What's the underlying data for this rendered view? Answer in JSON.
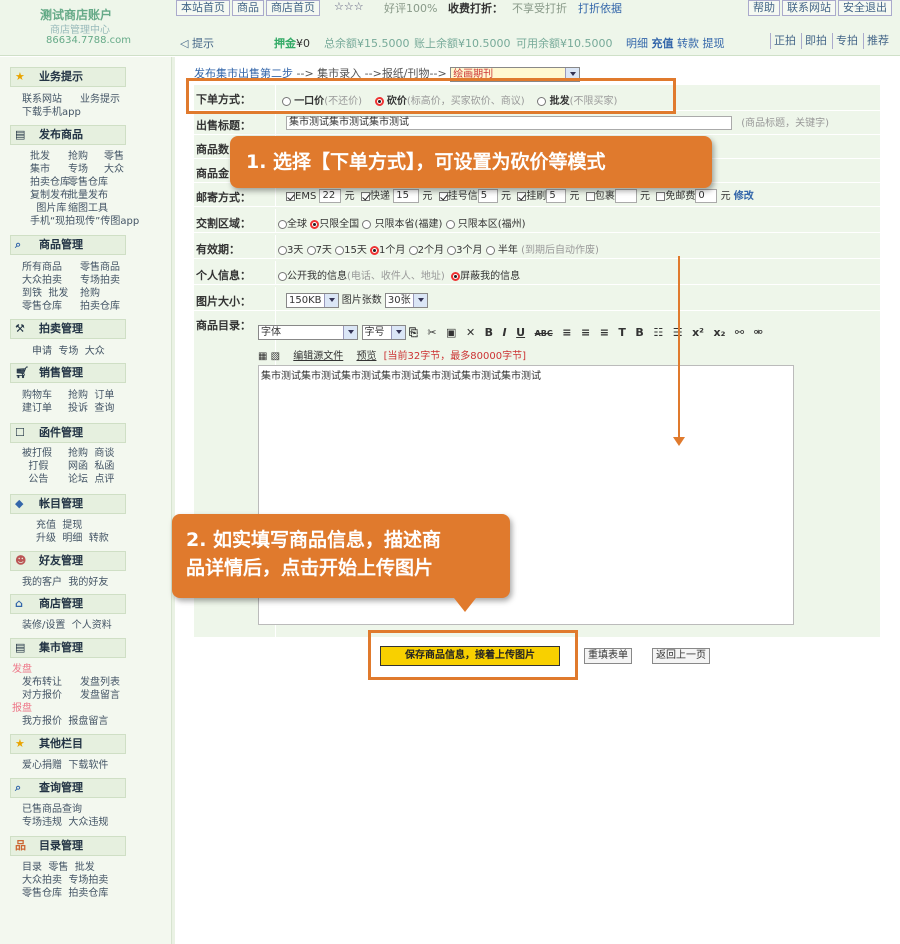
{
  "account": {
    "title": "测试商店账户",
    "subtitle": "商店管理中心",
    "domain": "86634.7788.com"
  },
  "topnav": {
    "items": [
      "本站首页",
      "商品",
      "商店首页"
    ],
    "stars": "☆☆☆",
    "rating": "好评100%",
    "fee_label": "收费打折：",
    "fee_value": "不享受打折",
    "fee_basis": "打折依据",
    "right": [
      "帮助",
      "联系网站",
      "安全退出"
    ]
  },
  "balance": {
    "tip": "提示",
    "deposit_label": "押金",
    "deposit": "¥0",
    "total": "总余额¥15.5000",
    "account": "账上余额¥10.5000",
    "available": "可用余额¥10.5000",
    "ops": [
      "明细",
      "充值",
      "转款",
      "提现"
    ],
    "sort": [
      "正拍",
      "即拍",
      "专拍",
      "推荐"
    ]
  },
  "sidebar": {
    "sections": [
      {
        "title": "业务提示",
        "icon": "star-icon",
        "left": "联系网站\n下载手机app",
        "right": "业务提示"
      },
      {
        "title": "发布商品",
        "icon": "document-icon",
        "left": "批发\n集市\n拍卖仓库\n复制发布\n  图片库\n手机“现拍现传”传图app",
        "right": "抢购\n专场\n零售仓库\n批量发布\n缩图工具",
        "right2": "零售\n大众"
      },
      {
        "title": "商品管理",
        "icon": "search-icon",
        "left": "所有商品\n大众拍卖\n到铁  批发\n零售仓库",
        "right": "零售商品\n专场拍卖\n抢购\n拍卖仓库"
      },
      {
        "title": "拍卖管理",
        "icon": "hammer-icon",
        "left": "申请  专场  大众"
      },
      {
        "title": "销售管理",
        "icon": "cart-icon",
        "left": "购物车\n建订单",
        "right": "抢购  订单\n投诉  查询"
      },
      {
        "title": "函件管理",
        "icon": "mail-icon",
        "left": "被打假\n  打假\n  公告",
        "right": "抢购  商谈\n网函  私函\n论坛  点评"
      },
      {
        "title": "帐目管理",
        "icon": "ticket-icon",
        "left": "充值  提现\n升级  明细  转款"
      },
      {
        "title": "好友管理",
        "icon": "people-icon",
        "left": "我的客户  我的好友"
      },
      {
        "title": "商店管理",
        "icon": "home-icon",
        "left": "装修/设置  个人资料"
      },
      {
        "title": "集市管理",
        "icon": "document-icon",
        "orange1": "发盘",
        "left": "发布转让\n对方报价",
        "right": "发盘列表\n发盘留言",
        "orange2": "报盘",
        "left2": "我方报价  报盘留言"
      },
      {
        "title": "其他栏目",
        "icon": "star-icon",
        "left": "爱心捐赠  下载软件"
      },
      {
        "title": "查询管理",
        "icon": "search-icon",
        "left": "已售商品查询\n专场违规  大众违规"
      },
      {
        "title": "目录管理",
        "icon": "tree-icon",
        "left": "目录  零售  批发\n大众拍卖  专场拍卖\n零售仓库  拍卖仓库"
      }
    ]
  },
  "breadcrumb": {
    "step": "发布集市出售第二步",
    "sep1": "-->",
    "cat1": "集市录入",
    "sep2": "-->",
    "cat2": "报纸/刊物",
    "sep3": "-->",
    "selected": "绘画期刊"
  },
  "form": {
    "order_mode": {
      "label": "下单方式：",
      "options": [
        {
          "name": "一口价",
          "hint": "(不还价)",
          "selected": false
        },
        {
          "name": "砍价",
          "hint": "(标高价，买家砍价、商议)",
          "selected": true
        },
        {
          "name": "批发",
          "hint": "(不限买家)",
          "selected": false
        }
      ]
    },
    "title": {
      "label": "出售标题：",
      "value": "集市测试集市测试集市测试",
      "hint": "(商品标题，关键字)"
    },
    "qty": {
      "label": "商品数"
    },
    "price": {
      "label": "商品金"
    },
    "shipping": {
      "label": "邮寄方式：",
      "ems": "EMS",
      "ems_val": "22",
      "express": "快递",
      "express_val": "15",
      "reg": "挂号信",
      "reg_val": "5",
      "print": "挂刷",
      "print_val": "5",
      "pkg": "包裹",
      "free": "免邮费",
      "free_val": "0",
      "unit": "元",
      "edit": "修改"
    },
    "region": {
      "label": "交割区域：",
      "options": [
        {
          "name": "全球",
          "sel": false
        },
        {
          "name": "只限全国",
          "sel": true
        },
        {
          "name": "只限本省(福建)",
          "sel": false
        },
        {
          "name": "只限本区(福州)",
          "sel": false
        }
      ]
    },
    "validity": {
      "label": "有效期：",
      "options": [
        {
          "name": "3天",
          "sel": false
        },
        {
          "name": "7天",
          "sel": false
        },
        {
          "name": "15天",
          "sel": false
        },
        {
          "name": "1个月",
          "sel": true
        },
        {
          "name": "2个月",
          "sel": false
        },
        {
          "name": "3个月",
          "sel": false
        },
        {
          "name": "半年",
          "sel": false
        }
      ],
      "hint": "(到期后自动作废)"
    },
    "personal": {
      "label": "个人信息：",
      "opt1": "公开我的信息",
      "opt1_hint": "(电话、收件人、地址)",
      "opt2": "屏蔽我的信息"
    },
    "image": {
      "label": "图片大小：",
      "size": "150KB",
      "count_label": "图片张数",
      "count": "30张"
    },
    "catalog": {
      "label": "商品目录："
    },
    "editor": {
      "font": "字体",
      "size": "字号",
      "edit_src": "编辑源文件",
      "preview": "预览",
      "counter": "[当前32字节，最多80000字节]",
      "content": "集市测试集市测试集市测试集市测试集市测试集市测试集市测试"
    }
  },
  "buttons": {
    "save": "保存商品信息，接着上传图片",
    "reset": "重填表单",
    "back": "返回上一页"
  },
  "callouts": {
    "c1": "1. 选择【下单方式】，可设置为砍价等模式",
    "c2a": "2. 如实填写商品信息，描述商",
    "c2b": "品详情后，点击开始上传图片"
  },
  "colors": {
    "accent": "#e07a2d",
    "panel": "#eef6ea",
    "button": "#f8d000"
  }
}
